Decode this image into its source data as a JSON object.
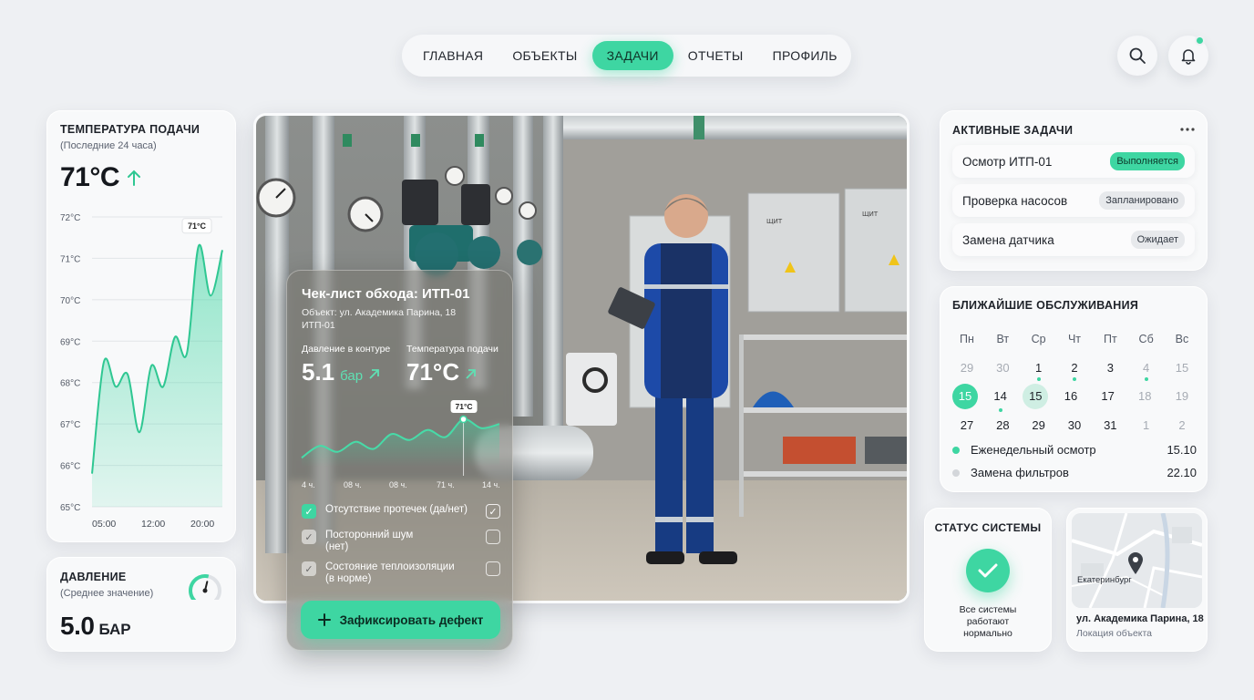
{
  "nav": {
    "items": [
      {
        "label": "ГЛАВНАЯ",
        "active": false
      },
      {
        "label": "ОБЪЕКТЫ",
        "active": false
      },
      {
        "label": "ЗАДАЧИ",
        "active": true
      },
      {
        "label": "ОТЧЕТЫ",
        "active": false
      },
      {
        "label": "ПРОФИЛЬ",
        "active": false
      }
    ],
    "search_icon": "search-icon",
    "bell_icon": "bell-icon"
  },
  "temperature": {
    "title": "ТЕМПЕРАТУРА ПОДАЧИ",
    "subtitle": "(Последние 24 часа)",
    "value": "71°C",
    "trend_icon": "arrow-up-icon",
    "tooltip": "71°C"
  },
  "pressure": {
    "title": "ДАВЛЕНИЕ",
    "subtitle": "(Среднее значение)",
    "value": "5.0",
    "unit": "БАР",
    "gauge_level": 0.55
  },
  "checklist": {
    "title": "Чек-лист обхода: ИТП-01",
    "object": "Объект: ул. Академика Парина, 18",
    "unit_name": "ИТП-01",
    "pressure_label": "Давление в контуре",
    "pressure_value": "5.1",
    "pressure_unit": "бар",
    "temp_label": "Температура подачи",
    "temp_value": "71°C",
    "tooltip": "71°C",
    "items": [
      {
        "label": "Отсутствие протечек (да/нет)",
        "left": "on",
        "right": "checked"
      },
      {
        "label": "Посторонний шум (нет)",
        "left": "soft",
        "right": "empty"
      },
      {
        "label": "Состояние теплоизоляции (в норме)",
        "left": "soft",
        "right": "empty"
      }
    ],
    "defect_button": "Зафиксировать дефект"
  },
  "tasks": {
    "title": "АКТИВНЫЕ ЗАДАЧИ",
    "menu_icon": "more-icon",
    "items": [
      {
        "name": "Осмотр ИТП-01",
        "status": "Выполняется"
      },
      {
        "name": "Проверка насосов",
        "status": "Запланировано"
      },
      {
        "name": "Замена датчика",
        "status": "Ожидает"
      }
    ]
  },
  "maintenance": {
    "title": "БЛИЖАЙШИЕ ОБСЛУЖИВАНИЯ",
    "weekdays": [
      "Пн",
      "Вт",
      "Ср",
      "Чт",
      "Пт",
      "Сб",
      "Вс"
    ],
    "weeks": [
      [
        "29",
        "30",
        "1",
        "2",
        "3",
        "4",
        "15"
      ],
      [
        "15",
        "14",
        "15",
        "16",
        "17",
        "18",
        "19"
      ],
      [
        "27",
        "28",
        "29",
        "30",
        "31",
        "1",
        "2"
      ]
    ],
    "events": [
      {
        "name": "Еженедельный осмотр",
        "date": "15.10",
        "color": "#3ed6a2"
      },
      {
        "name": "Замена фильтров",
        "date": "22.10",
        "color": "#d3d6da"
      }
    ]
  },
  "system_status": {
    "title": "СТАТУС СИСТЕМЫ",
    "icon": "check-icon",
    "message": "Все системы работают нормально"
  },
  "location": {
    "city": "Екатеринбург",
    "address": "ул. Академика Парина, 18",
    "caption": "Локация объекта",
    "pin_icon": "map-pin-icon"
  },
  "chart_data": [
    {
      "type": "area",
      "title": "",
      "x_ticks": [
        "05:00",
        "12:00",
        "20:00"
      ],
      "y_ticks": [
        "72°C",
        "71°C",
        "70°C",
        "69°C",
        "68°C",
        "67°C",
        "66°C",
        "65°C"
      ],
      "ylim": [
        65,
        72
      ],
      "grid": true,
      "series": [
        {
          "values": [
            65.8,
            68.5,
            67.9,
            68.2,
            66.8,
            68.4,
            67.9,
            69.1,
            68.7,
            71.3,
            70.1,
            71.2
          ]
        }
      ]
    },
    {
      "type": "area",
      "title": "",
      "x_ticks": [
        "4 ч.",
        "08 ч.",
        "08 ч.",
        "71 ч.",
        "14 ч."
      ],
      "ylim": [
        0,
        1
      ],
      "grid": false,
      "series": [
        {
          "values": [
            0.15,
            0.35,
            0.25,
            0.42,
            0.3,
            0.55,
            0.45,
            0.62,
            0.5,
            0.8,
            0.65,
            0.72
          ]
        }
      ]
    }
  ]
}
